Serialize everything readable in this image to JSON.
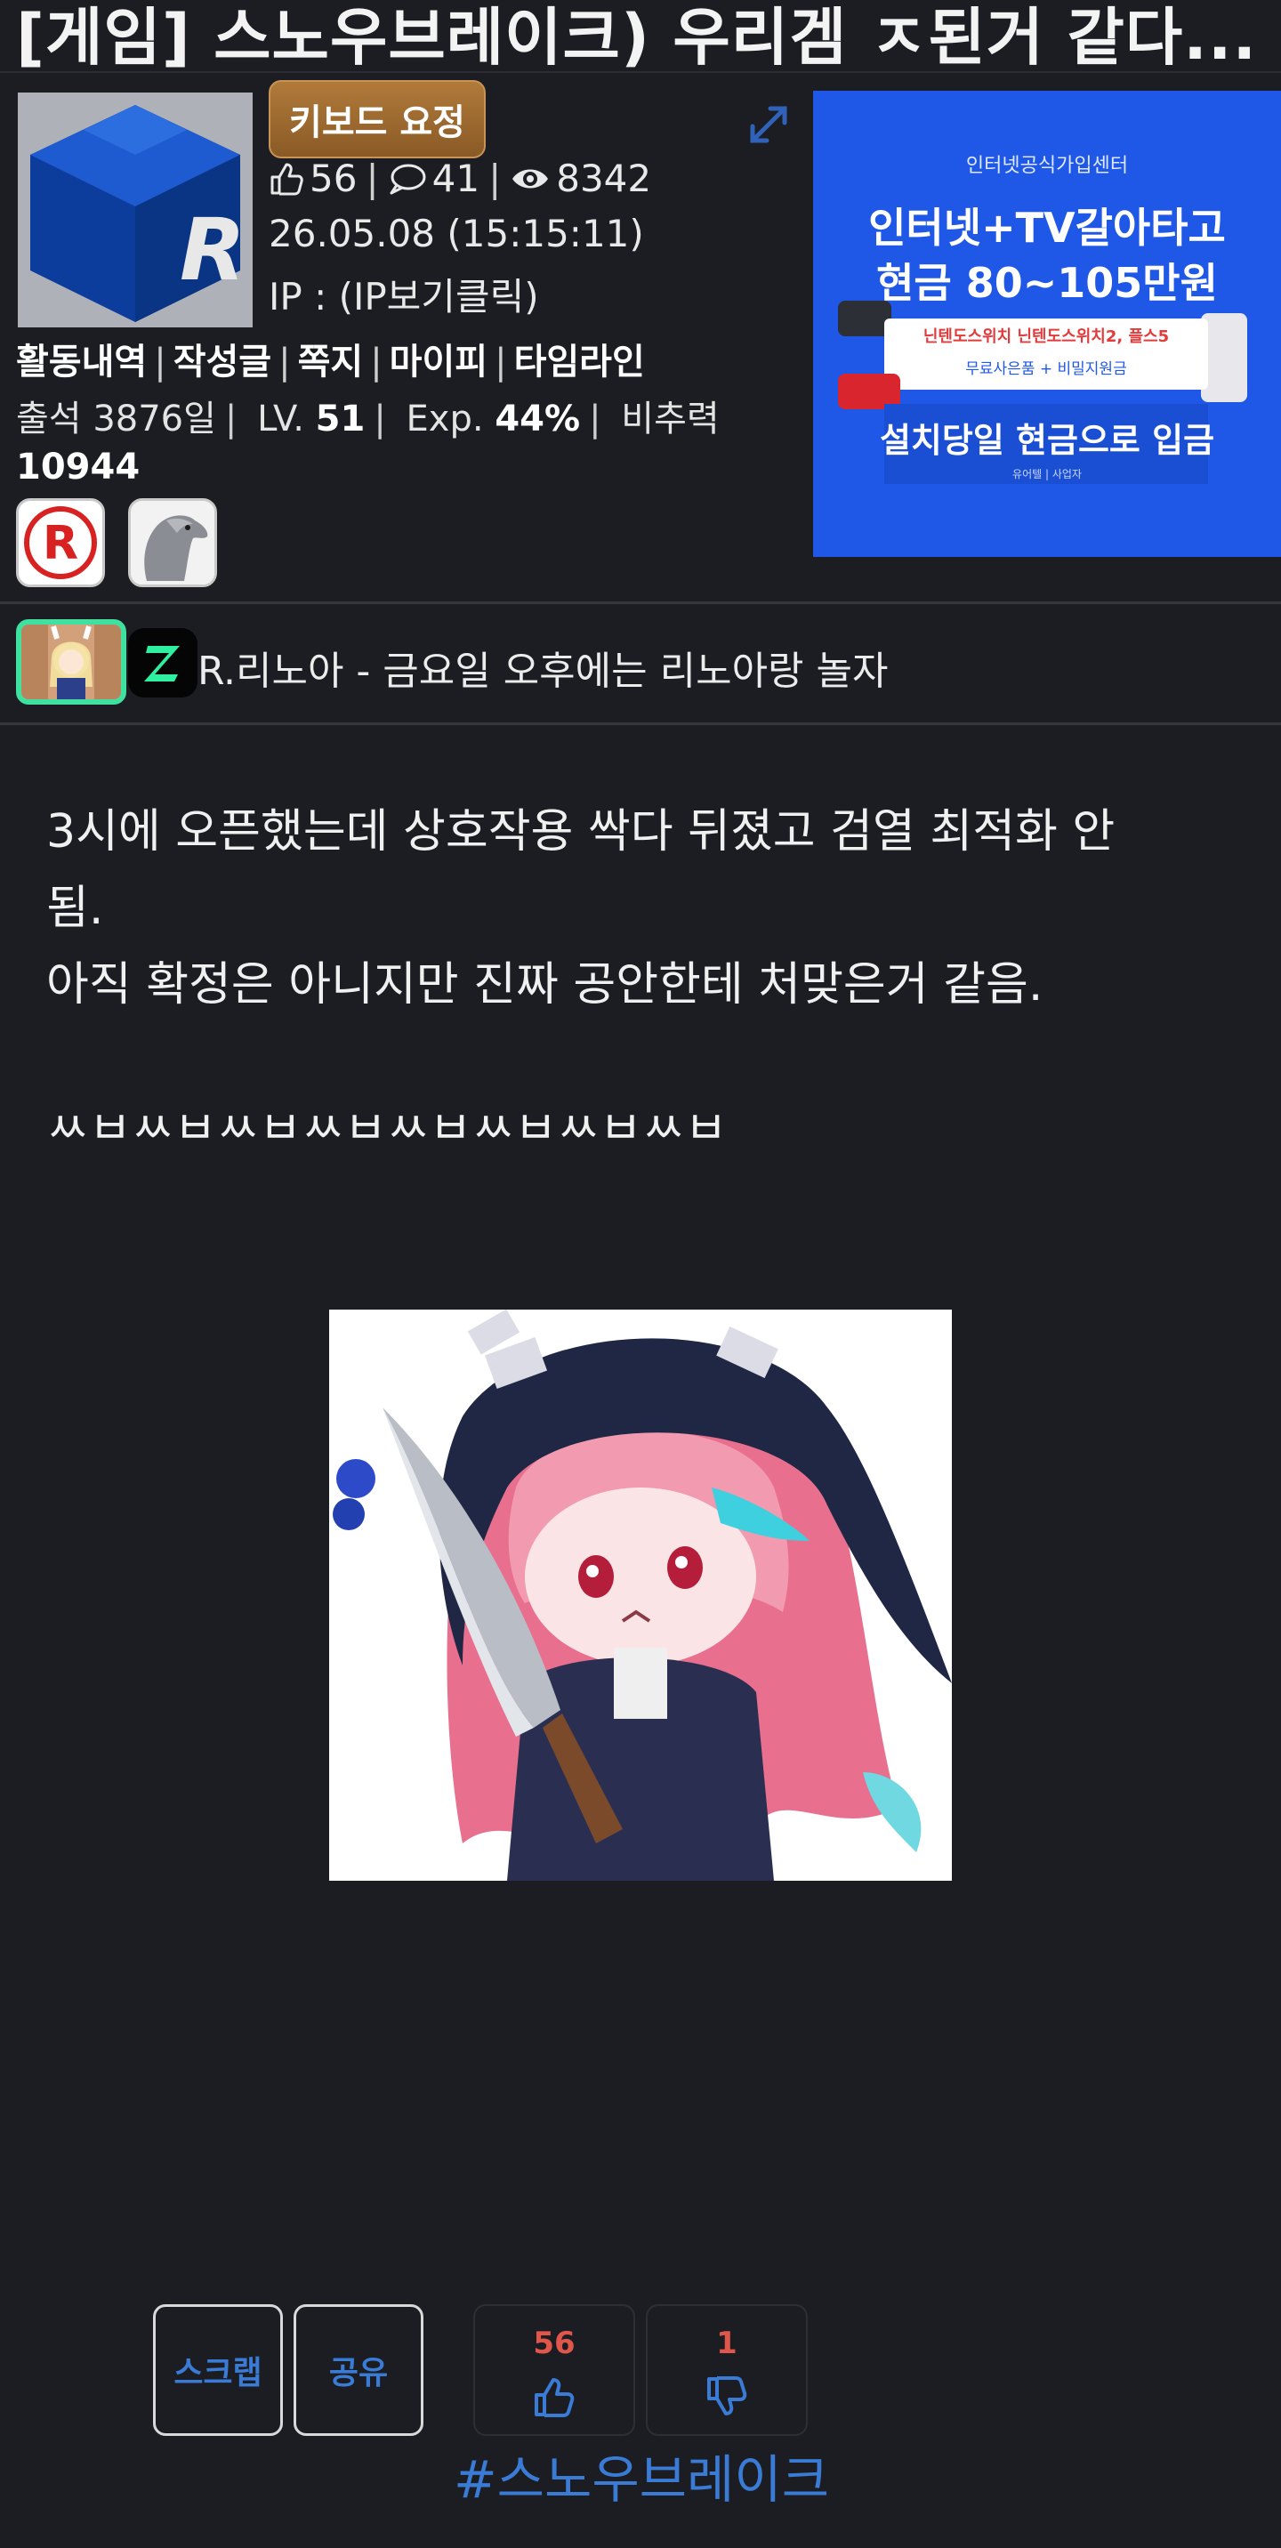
{
  "post": {
    "title": "[게임] 스노우브레이크) 우리겜 ㅈ된거 같다...",
    "body_lines": [
      "3시에 오픈했는데 상호작용 싹다 뒤졌고 검열 최적화 안",
      "됨.",
      "아직 확정은 아니지만 진짜 공안한테 처맞은거 같음.",
      "ㅆㅂㅆㅂㅆㅂㅆㅂㅆㅂㅆㅂㅆㅂㅆㅂ"
    ],
    "tag": "#스노우브레이크"
  },
  "author": {
    "badge_label": "키보드 요정",
    "likes": "56",
    "comments": "41",
    "views": "8342",
    "date": "26.05.08 (15:15:11)",
    "ip": "IP : (IP보기클릭)",
    "links": [
      "활동내역",
      "작성글",
      "쪽지",
      "마이피",
      "타임라인"
    ],
    "attendance_label": "출석 3876일",
    "level_label": "LV.",
    "level": "51",
    "exp_label": "Exp.",
    "exp": "44%",
    "points_label": "비추력",
    "points": "10944",
    "signature": "R.리노아 - 금요일 오후에는 리노아랑 놀자"
  },
  "ad": {
    "top": "인터넷공식가입센터",
    "headline1": "인터넷+TV갈아타고",
    "headline2": "현금 80~105만원",
    "sub1": "닌텐도스위치 닌텐도스위치2, 플스5",
    "sub2": "무료사은품 + 비밀지원금",
    "headline3": "설치당일 현금으로 입금",
    "footer": "유어텔 | 사업자"
  },
  "actions": {
    "scrap_label": "스크랩",
    "share_label": "공유",
    "upvotes": "56",
    "downvotes": "1"
  },
  "colors": {
    "background": "#1b1d22",
    "accent_blue": "#3a7bd5",
    "vote_red": "#e0564a",
    "badge_gold": "#a06d33",
    "signature_green": "#3fe0a0",
    "ad_blue": "#1f58e6"
  },
  "icons": [
    "thumbs-up-icon",
    "comment-icon",
    "eye-icon",
    "expand-icon",
    "thumbs-down-icon"
  ]
}
